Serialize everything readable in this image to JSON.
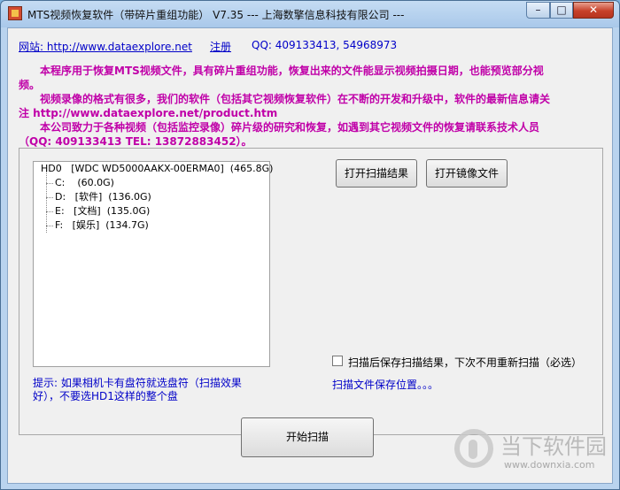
{
  "window": {
    "title": "MTS视频恢复软件（带碎片重组功能） V7.35 --- 上海数擎信息科技有限公司 ---",
    "min_glyph": "–",
    "max_glyph": "□",
    "close_glyph": "✕"
  },
  "header": {
    "website": "网站: http://www.dataexplore.net",
    "register": "注册",
    "qq": "QQ: 409133413, 54968973"
  },
  "intro": {
    "p1": "本程序用于恢复MTS视频文件，具有碎片重组功能，恢复出来的文件能显示视频拍摄日期，也能预览部分视频。",
    "p2": "视频录像的格式有很多，我们的软件（包括其它视频恢复软件）在不断的开发和升级中，软件的最新信息请关注 http://www.dataexplore.net/product.htm",
    "p3": "本公司致力于各种视频（包括监控录像）碎片级的研究和恢复，如遇到其它视频文件的恢复请联系技术人员（QQ: 409133413 TEL: 13872883452）。"
  },
  "tree": {
    "root": "HD0   [WDC WD5000AAKX-00ERMA0]  (465.8G)",
    "items": [
      "C:    (60.0G)",
      "D:   [软件]  (136.0G)",
      "E:   [文档]  (135.0G)",
      "F:   [娱乐]  (134.7G)"
    ]
  },
  "buttons": {
    "open_result": "打开扫描结果",
    "open_image": "打开镜像文件",
    "start_scan": "开始扫描"
  },
  "options": {
    "save_after_scan": "扫描后保存扫描结果，下次不用重新扫描（必选）",
    "save_after_scan_checked": false,
    "save_location": "扫描文件保存位置。。。"
  },
  "tip": "提示: 如果相机卡有盘符就选盘符（扫描效果好），不要选HD1这样的整个盘",
  "watermark": {
    "text": "当下软件园",
    "url": "www.downxia.com"
  }
}
